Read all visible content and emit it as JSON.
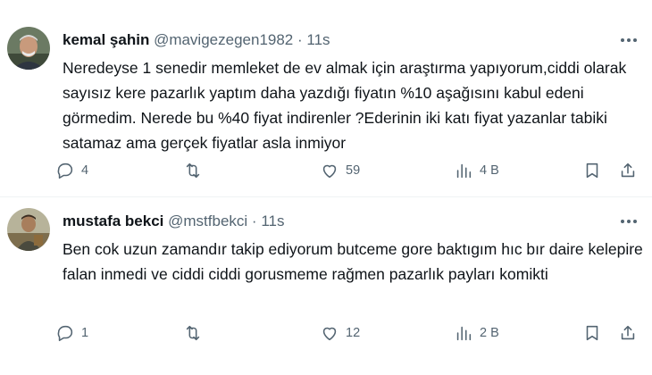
{
  "tweets": [
    {
      "name": "kemal şahin",
      "handle": "@mavigezegen1982",
      "separator": "·",
      "time": "11s",
      "text": "Neredeyse 1 senedir memleket de ev almak için araştırma yapıyorum,ciddi olarak  sayısız kere pazarlık yaptım daha yazdığı fiyatın %10 aşağısını kabul edeni görmedim. Nerede bu %40 fiyat indirenler ?Ederinin iki katı fiyat yazanlar tabiki satamaz ama gerçek fiyatlar asla inmiyor",
      "replies": "4",
      "retweets": "",
      "likes": "59",
      "views": "4 B"
    },
    {
      "name": "mustafa bekci",
      "handle": "@mstfbekci",
      "separator": "·",
      "time": "11s",
      "text": "Ben cok uzun zamandır takip ediyorum butceme gore baktıgım hıc bır daire kelepire falan inmedi ve ciddi ciddi gorusmeme rağmen pazarlık payları komikti",
      "replies": "1",
      "retweets": "",
      "likes": "12",
      "views": "2 B"
    }
  ],
  "icons": {
    "more": "more-horizontal-icon",
    "reply": "reply-icon",
    "retweet": "retweet-icon",
    "like": "heart-icon",
    "views": "views-chart-icon",
    "bookmark": "bookmark-icon",
    "share": "share-icon"
  },
  "colors": {
    "text": "#0f1419",
    "secondary": "#536471",
    "divider": "#eff3f4"
  }
}
